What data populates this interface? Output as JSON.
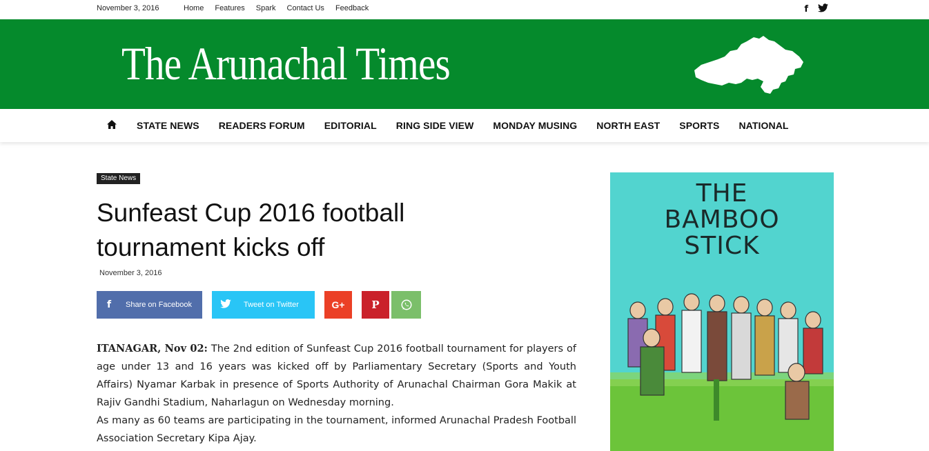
{
  "topbar": {
    "date": "November 3, 2016",
    "links": [
      "Home",
      "Features",
      "Spark",
      "Contact Us",
      "Feedback"
    ],
    "social": {
      "facebook": "f",
      "twitter": "twitter-icon"
    }
  },
  "header": {
    "logo_text": "The Arunachal Times",
    "map_icon": "arunachal-map-icon",
    "bg_color": "#058a2c"
  },
  "nav": {
    "home_icon": "home-icon",
    "items": [
      "STATE NEWS",
      "READERS FORUM",
      "EDITORIAL",
      "RING SIDE VIEW",
      "MONDAY MUSING",
      "NORTH EAST",
      "SPORTS",
      "NATIONAL"
    ]
  },
  "article": {
    "category": "State News",
    "title": "Sunfeast Cup 2016 football tournament kicks off",
    "date": "November 3, 2016",
    "share": {
      "facebook": "Share on Facebook",
      "twitter": "Tweet on Twitter",
      "google_plus_icon": "G+",
      "pinterest_icon": "pinterest-icon",
      "whatsapp_icon": "whatsapp-icon"
    },
    "dateline": "ITANAGAR, Nov 02:",
    "para1": " The 2nd edition of Sunfeast Cup 2016 football tournament for players of age under 13 and 16 years was kicked off by Parliamentary Secretary (Sports and Youth Affairs) Nyamar Karbak in presence of Sports Authority of Arunachal Chairman Gora Makik at Rajiv Gandhi Stadium, Naharlagun on Wednesday morning.",
    "para2": "As many as 60 teams are participating in the tournament, informed Arunachal Pradesh Football Association Secretary Kipa Ajay."
  },
  "sidebar": {
    "ad_title_line1": "THE",
    "ad_title_line2": "BAMBOO",
    "ad_title_line3": "STICK"
  }
}
